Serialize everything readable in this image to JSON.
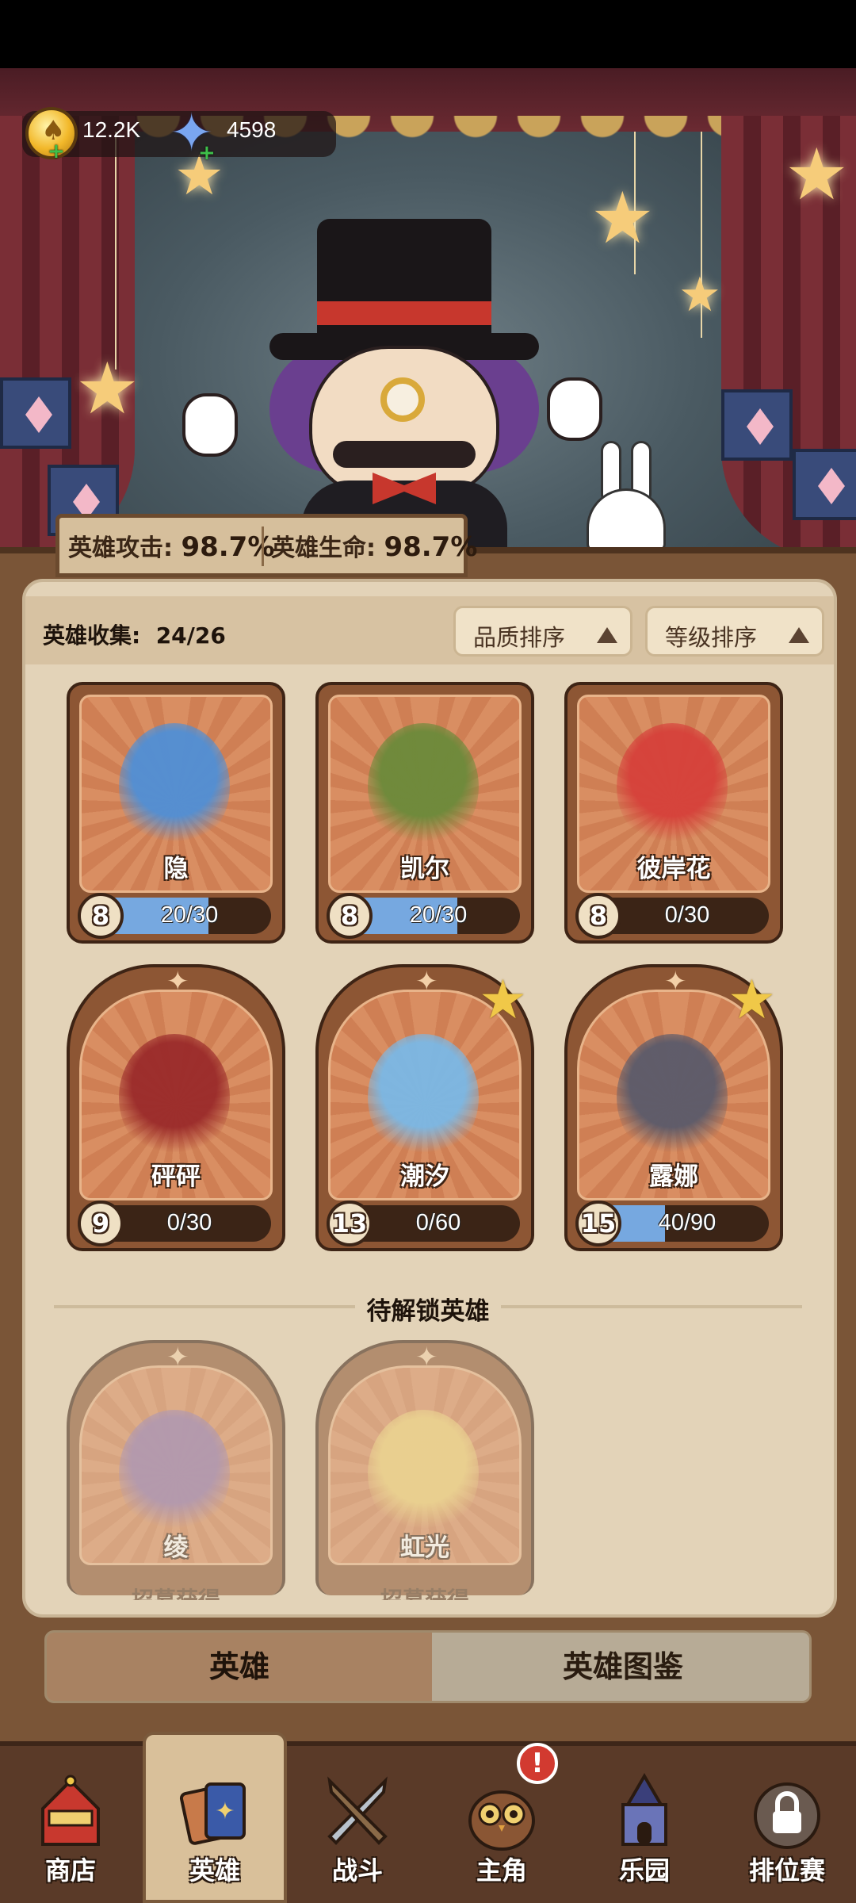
{
  "currency": {
    "coins": "12.2K",
    "gems": "4598"
  },
  "stats": {
    "attack_label": "英雄攻击:",
    "attack_value": "98.7%",
    "hp_label": "英雄生命:",
    "hp_value": "98.7%"
  },
  "collection": {
    "label": "英雄收集:",
    "count": "24/26"
  },
  "sort": {
    "quality": "品质排序",
    "level": "等级排序"
  },
  "heroes": [
    {
      "name": "隐",
      "level": "8",
      "progress": "20/30",
      "fill": 0.667,
      "starred": false,
      "art_color": "#4f8fd6"
    },
    {
      "name": "凯尔",
      "level": "8",
      "progress": "20/30",
      "fill": 0.667,
      "starred": false,
      "art_color": "#6b8a3a"
    },
    {
      "name": "彼岸花",
      "level": "8",
      "progress": "0/30",
      "fill": 0,
      "starred": false,
      "art_color": "#d6403a"
    },
    {
      "name": "砰砰",
      "level": "9",
      "progress": "0/30",
      "fill": 0,
      "starred": false,
      "art_color": "#9a2a2a"
    },
    {
      "name": "潮汐",
      "level": "13",
      "progress": "0/60",
      "fill": 0,
      "starred": true,
      "art_color": "#7ab8e6"
    },
    {
      "name": "露娜",
      "level": "15",
      "progress": "40/90",
      "fill": 0.444,
      "starred": true,
      "art_color": "#5a5a6a"
    }
  ],
  "locked_section": {
    "title": "待解锁英雄",
    "heroes": [
      {
        "name": "绫",
        "subtitle": "招募获得",
        "art_color": "#8a6aa8"
      },
      {
        "name": "虹光",
        "subtitle": "招募获得",
        "art_color": "#f0d070"
      }
    ]
  },
  "tabs": {
    "heroes": "英雄",
    "codex": "英雄图鉴"
  },
  "nav": [
    {
      "label": "商店",
      "icon": "shop-tent-icon"
    },
    {
      "label": "英雄",
      "icon": "hero-cards-icon"
    },
    {
      "label": "战斗",
      "icon": "battle-swords-icon"
    },
    {
      "label": "主角",
      "icon": "owl-protagonist-icon"
    },
    {
      "label": "乐园",
      "icon": "castle-park-icon"
    },
    {
      "label": "排位赛",
      "icon": "lock-icon"
    }
  ],
  "alert_badge": "!"
}
